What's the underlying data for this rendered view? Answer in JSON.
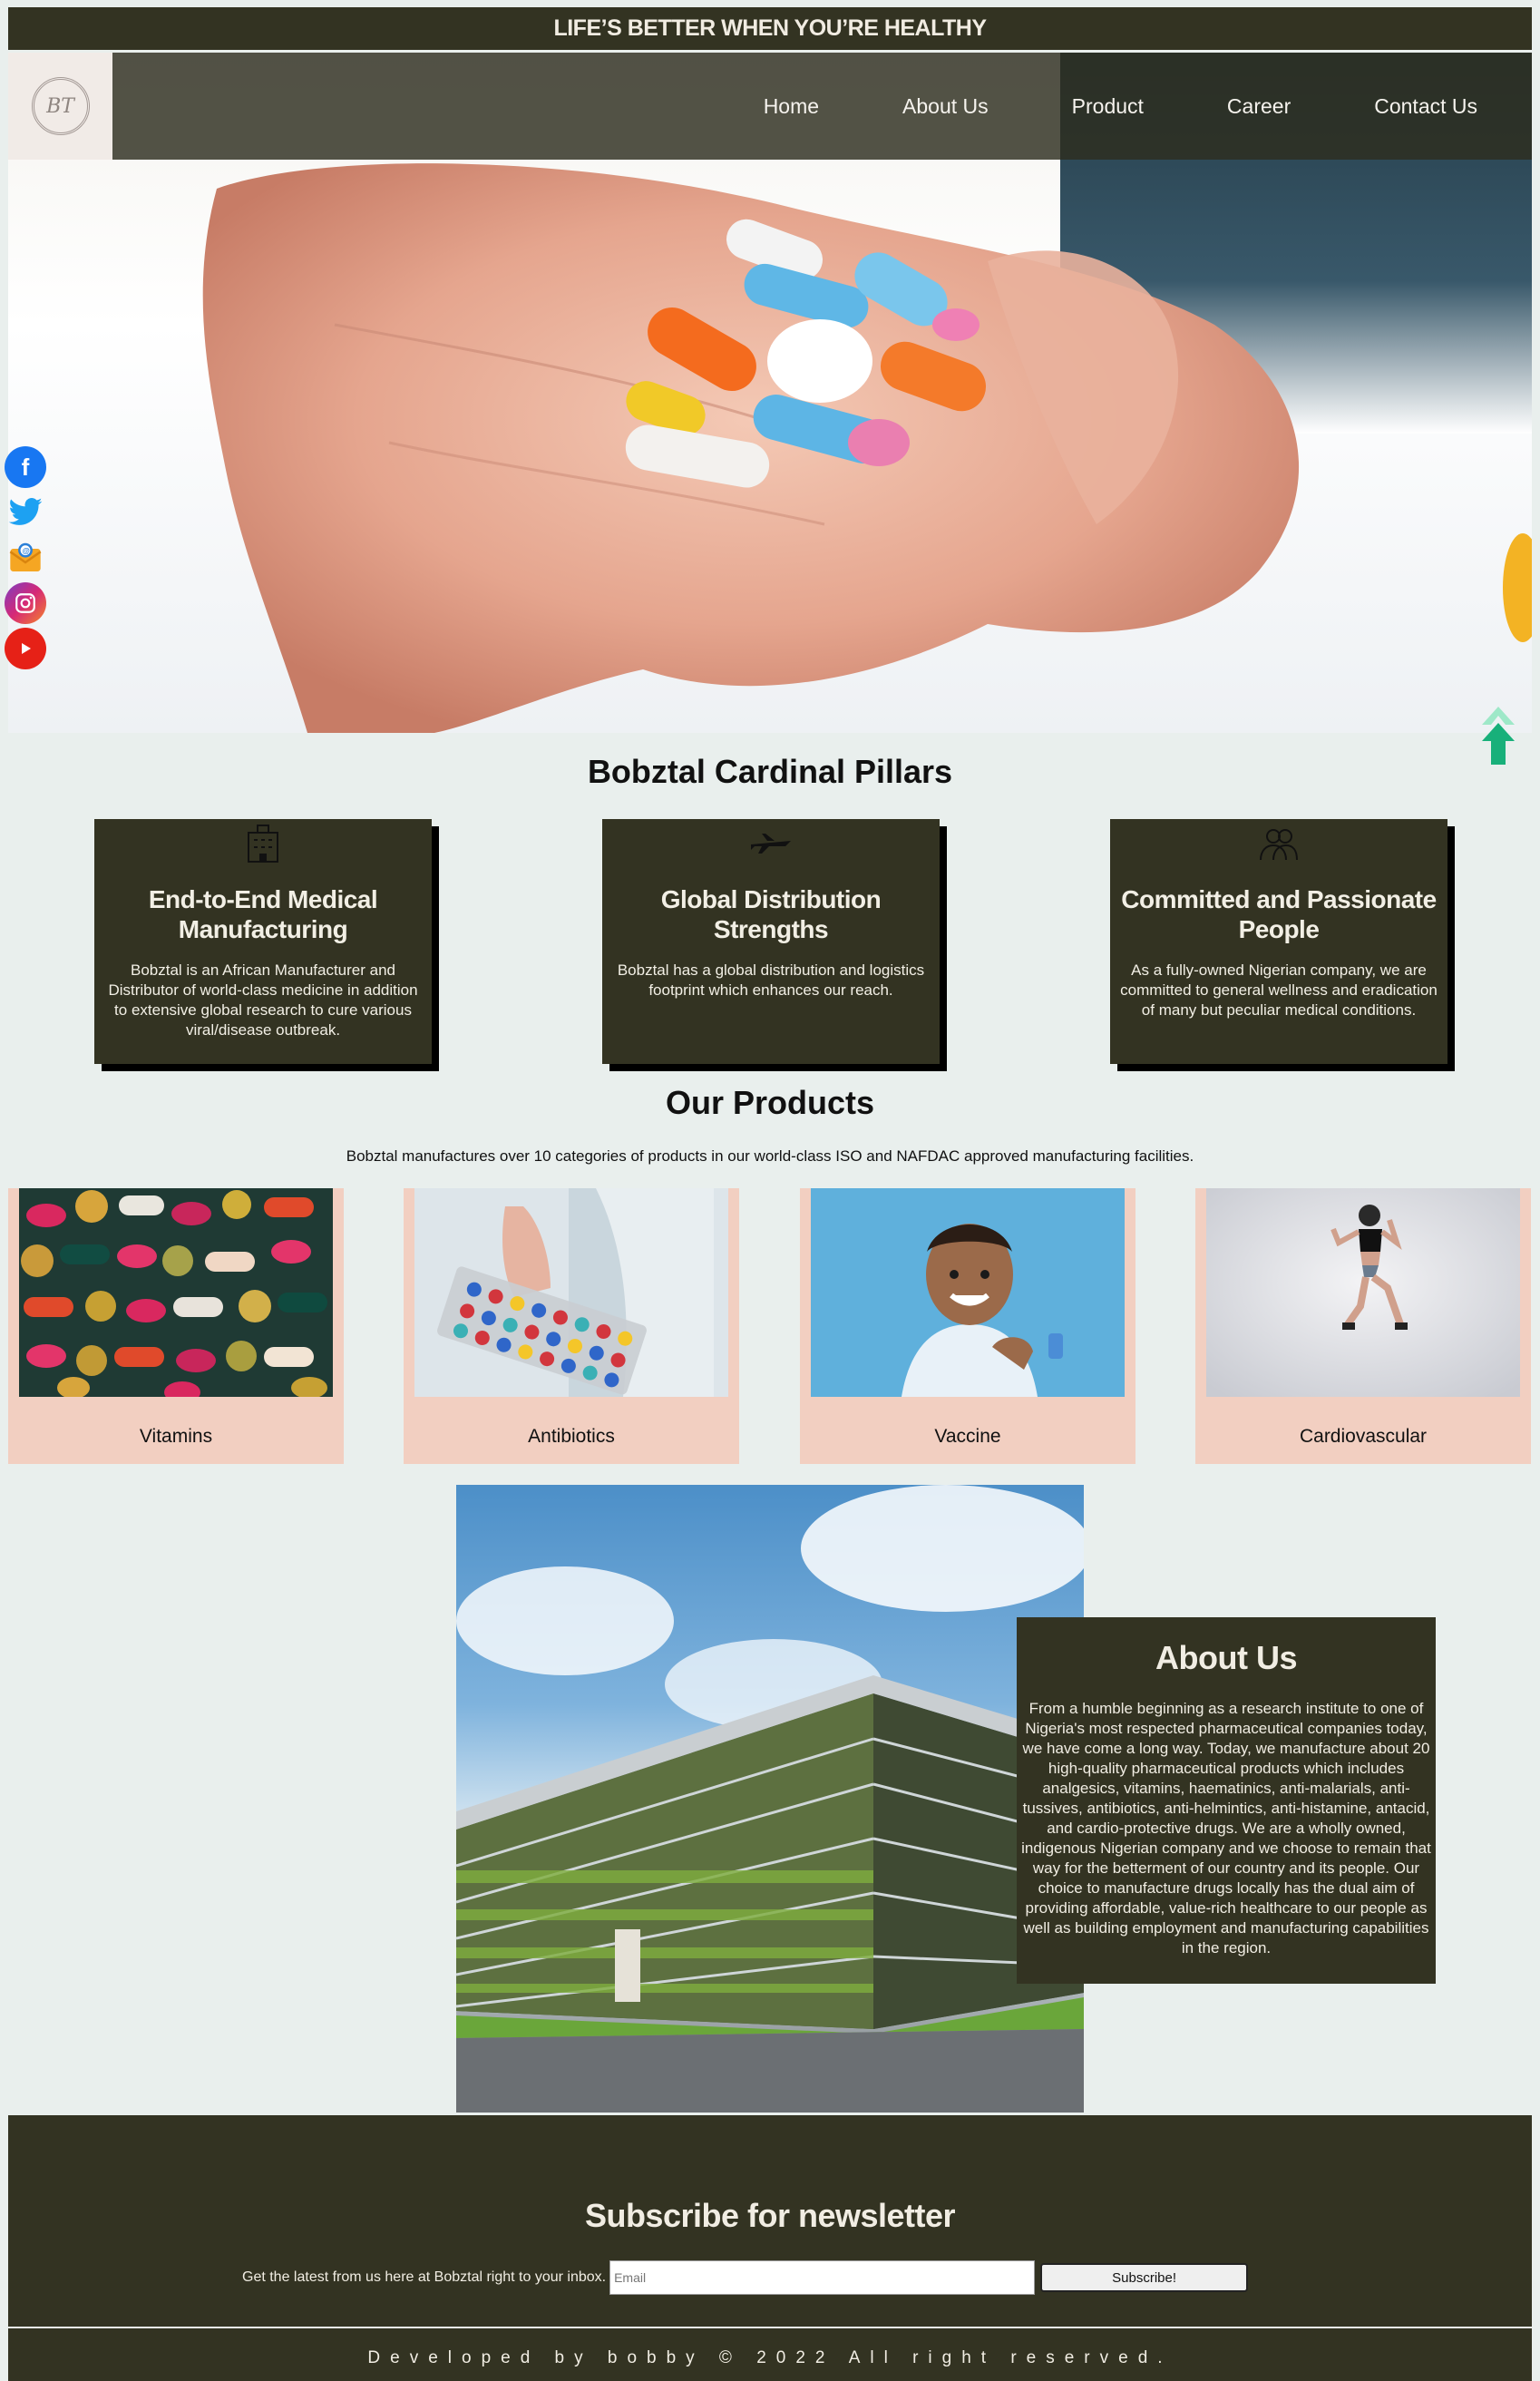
{
  "topbar": {
    "tagline": "LIFE’S BETTER WHEN YOU’RE HEALTHY"
  },
  "nav": {
    "logo_text": "BT",
    "items": [
      {
        "label": "Home"
      },
      {
        "label": "About Us"
      },
      {
        "label": "Product"
      },
      {
        "label": "Career"
      },
      {
        "label": "Contact Us"
      }
    ]
  },
  "social": [
    {
      "icon": "facebook-icon",
      "color": "#1877f2"
    },
    {
      "icon": "twitter-icon",
      "color": "#1da1f2"
    },
    {
      "icon": "email-icon",
      "color": "#f5a623"
    },
    {
      "icon": "instagram-icon",
      "color": "#c13584"
    },
    {
      "icon": "youtube-icon",
      "color": "#e62117"
    }
  ],
  "pillars": {
    "title": "Bobztal Cardinal Pillars",
    "items": [
      {
        "icon": "factory-icon",
        "title": "End-to-End Medical Manufacturing",
        "text": "Bobztal is an African Manufacturer and Distributor of world-class medicine in addition to extensive global research to cure various viral/disease outbreak."
      },
      {
        "icon": "airplane-icon",
        "title": "Global Distribution Strengths",
        "text": "Bobztal has a global distribution and logistics footprint which enhances our reach."
      },
      {
        "icon": "people-icon",
        "title": "Committed and Passionate People",
        "text": "As a fully-owned Nigerian company, we are committed to general wellness and eradication of many but peculiar medical conditions."
      }
    ]
  },
  "products": {
    "title": "Our Products",
    "subtitle": "Bobztal manufactures over 10 categories of products in our world-class ISO and NAFDAC approved manufacturing facilities.",
    "items": [
      {
        "label": "Vitamins"
      },
      {
        "label": "Antibiotics"
      },
      {
        "label": "Vaccine"
      },
      {
        "label": "Cardiovascular"
      }
    ]
  },
  "about": {
    "title": "About Us",
    "text": "From a humble beginning as a research institute to one of Nigeria's most respected pharmaceutical companies today, we have come a long way. Today, we manufacture about 20 high-quality pharmaceutical products which includes analgesics, vitamins, haematinics, anti-malarials, anti-tussives, antibiotics, anti-helmintics, anti-histamine, antacid, and cardio-protective drugs. We are a wholly owned, indigenous Nigerian company and we choose to remain that way for the betterment of our country and its people. Our choice to manufacture drugs locally has the dual aim of providing affordable, value-rich healthcare to our people as well as building employment and manufacturing capabilities in the region."
  },
  "newsletter": {
    "title": "Subscribe for newsletter",
    "text": "Get the latest from us here at Bobztal right to your inbox.",
    "placeholder": "Email",
    "button": "Subscribe!"
  },
  "footer": {
    "text": "Developed by bobby © 2022 All right reserved."
  },
  "colors": {
    "dark": "#333322",
    "product_card": "#f2cfc1",
    "page_bg": "#e9efed"
  }
}
